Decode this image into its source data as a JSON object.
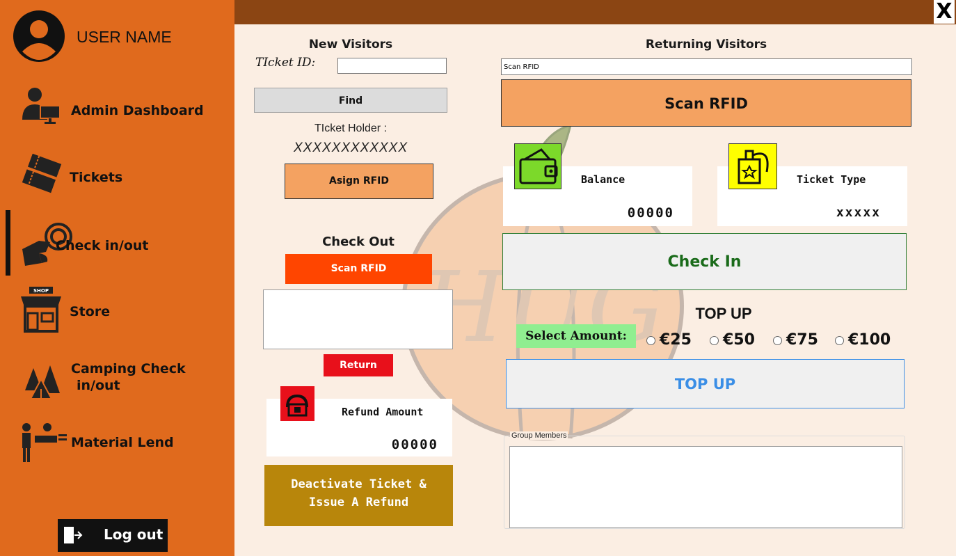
{
  "window": {
    "close_label": "X"
  },
  "user": {
    "name": "USER NAME"
  },
  "sidebar": {
    "items": [
      {
        "label": "Admin Dashboard"
      },
      {
        "label": "Tickets"
      },
      {
        "label": "Check in/out"
      },
      {
        "label": "Store"
      },
      {
        "label": "Camping Check"
      },
      {
        "label": "Material Lend"
      }
    ],
    "camping_line2": "in/out",
    "logout_label": "Log out"
  },
  "new_visitors": {
    "title": "New Visitors",
    "ticket_id_label": "TIcket ID:",
    "ticket_id_value": "",
    "find_label": "Find",
    "holder_label": "TIcket Holder :",
    "holder_value": "XXXXXXXXXXXX",
    "assign_label": "Asign RFID"
  },
  "check_out": {
    "title": "Check Out",
    "scan_label": "Scan RFID",
    "return_label": "Return",
    "refund_label": "Refund Amount",
    "refund_value": "00000",
    "deactivate_line1": "Deactivate Ticket &",
    "deactivate_line2": "Issue A Refund"
  },
  "returning": {
    "title": "Returning Visitors",
    "scan_input_value": "Scan RFID",
    "scan_button_label": "Scan RFID",
    "balance_label": "Balance",
    "balance_value": "00000",
    "ticket_type_label": "Ticket Type",
    "ticket_type_value": "xxxxx",
    "checkin_label": "Check In",
    "topup_title": "TOP UP",
    "select_amount_label": "Select Amount:",
    "amounts": [
      "€25",
      "€50",
      "€75",
      "€100"
    ],
    "topup_button_label": "TOP UP",
    "group_members_label": "Group Members"
  },
  "colors": {
    "sidebar": "#e06a1d",
    "topbar": "#8b4513",
    "content_bg": "#fbeee3",
    "peach_button": "#f4a261",
    "scan_red": "#ff4500",
    "return_red": "#e8101b",
    "deactivate_gold": "#b8860b",
    "checkin_green": "#1a6b1a",
    "topup_blue": "#3a8ee6",
    "select_amount_bg": "#90ee90",
    "wallet_icon_bg": "#7cd92a",
    "badge_icon_bg": "#ffff00"
  }
}
